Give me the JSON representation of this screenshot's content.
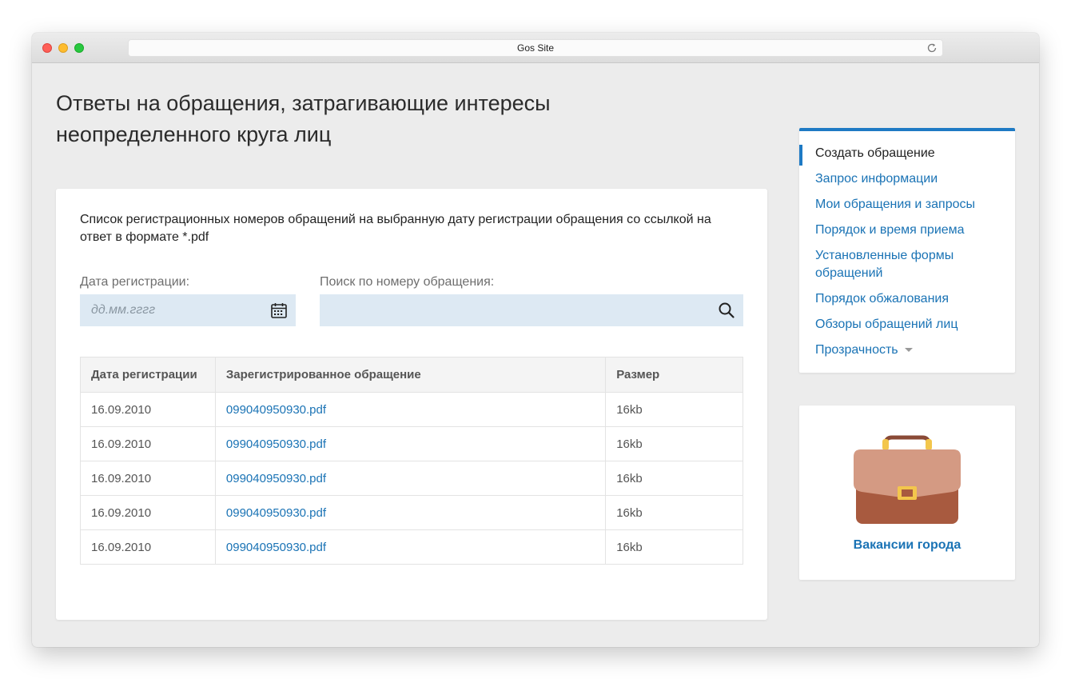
{
  "browser": {
    "url_text": "Gos Site"
  },
  "page": {
    "title": "Ответы на обращения, затрагивающие интересы неопределенного круга лиц"
  },
  "card": {
    "description": "Список регистрационных номеров обращений на выбранную дату регистрации обращения со ссылкой на ответ в формате *.pdf",
    "date_label": "Дата регистрации:",
    "date_placeholder": "дд.мм.гггг",
    "search_label": "Поиск по номеру обращения:",
    "search_value": ""
  },
  "table": {
    "headers": [
      "Дата регистрации",
      "Зарегистрированное обращение",
      "Размер"
    ],
    "rows": [
      {
        "date": "16.09.2010",
        "file": "099040950930.pdf",
        "size": "16kb"
      },
      {
        "date": "16.09.2010",
        "file": "099040950930.pdf",
        "size": "16kb"
      },
      {
        "date": "16.09.2010",
        "file": "099040950930.pdf",
        "size": "16kb"
      },
      {
        "date": "16.09.2010",
        "file": "099040950930.pdf",
        "size": "16kb"
      },
      {
        "date": "16.09.2010",
        "file": "099040950930.pdf",
        "size": "16kb"
      }
    ]
  },
  "sidebar": {
    "items": [
      {
        "label": "Создать обращение",
        "active": true
      },
      {
        "label": "Запрос информации"
      },
      {
        "label": "Мои обращения и запросы"
      },
      {
        "label": "Порядок и время приема"
      },
      {
        "label": "Установленные формы обращений"
      },
      {
        "label": "Порядок обжалования"
      },
      {
        "label": "Обзоры обращений лиц"
      },
      {
        "label": "Прозрачность",
        "has_dropdown": true
      }
    ]
  },
  "promo": {
    "label": "Вакансии города",
    "icon": "briefcase-icon"
  },
  "colors": {
    "accent": "#1e7ac4",
    "link": "#1a73b5",
    "input_bg": "#dde9f3",
    "page_bg": "#ececec"
  }
}
